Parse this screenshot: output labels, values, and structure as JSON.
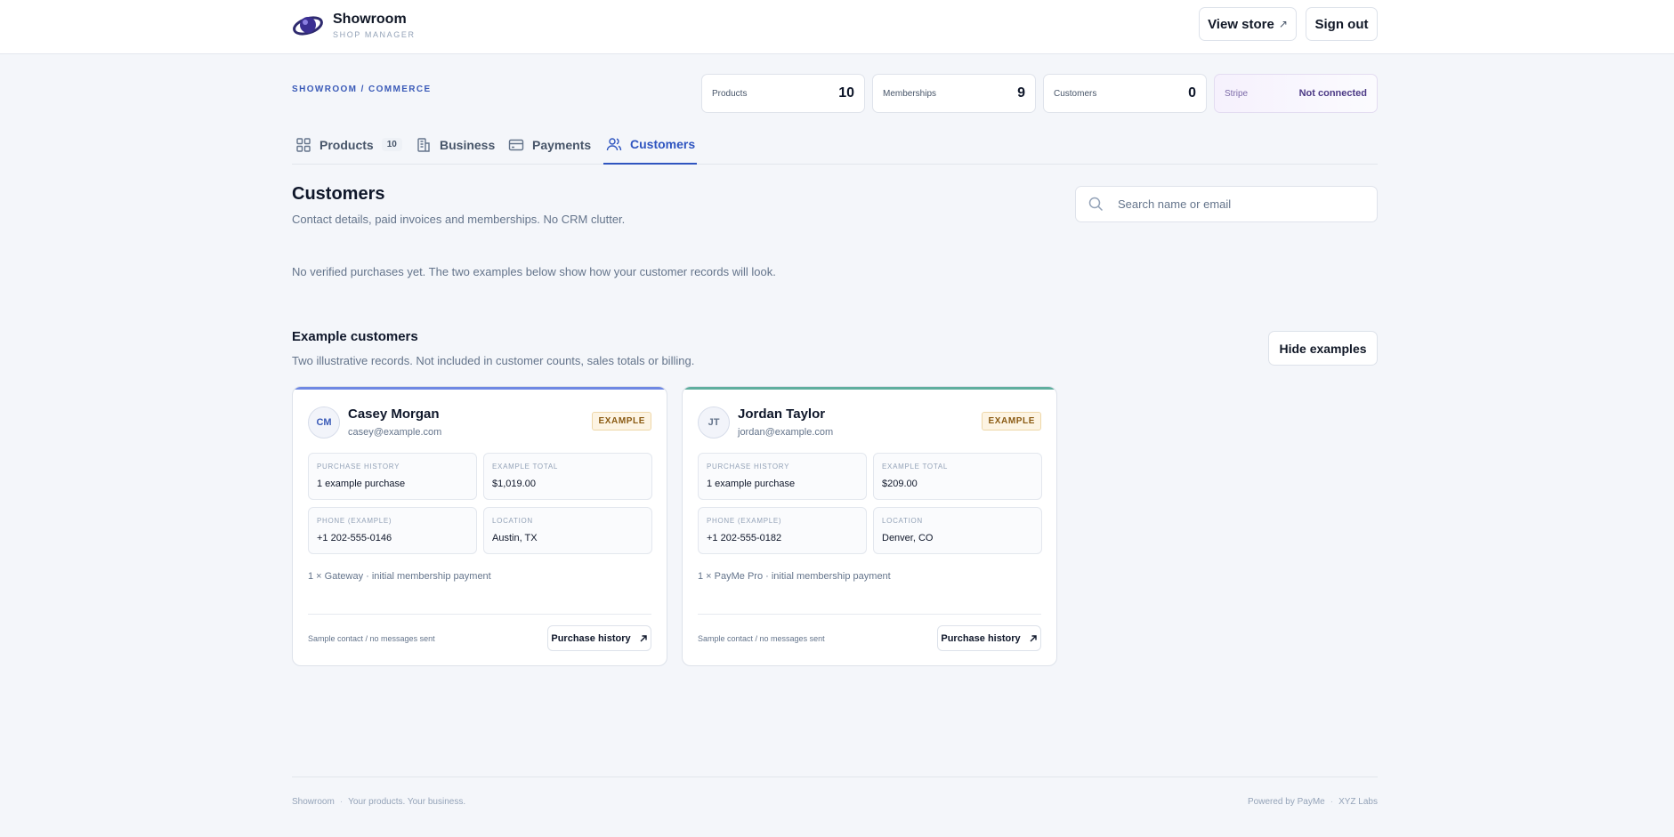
{
  "header": {
    "brand_name": "Showroom",
    "brand_sub": "SHOP MANAGER",
    "view_store_label": "View store",
    "sign_out_label": "Sign out"
  },
  "breadcrumb": "SHOWROOM / COMMERCE",
  "stats": [
    {
      "label": "Products",
      "value": "10"
    },
    {
      "label": "Memberships",
      "value": "9"
    },
    {
      "label": "Customers",
      "value": "0"
    },
    {
      "label": "Stripe",
      "value": "Not connected"
    }
  ],
  "tabs": [
    {
      "label": "Products",
      "badge": "10",
      "icon": "grid-icon"
    },
    {
      "label": "Business",
      "icon": "building-icon"
    },
    {
      "label": "Payments",
      "icon": "card-icon"
    },
    {
      "label": "Customers",
      "icon": "users-icon",
      "active": true
    }
  ],
  "main": {
    "title": "Customers",
    "subtitle": "Contact details, paid invoices and memberships. No CRM clutter.",
    "search_placeholder": "Search name or email",
    "notice": "No verified purchases yet. The two examples below show how your customer records will look."
  },
  "examples": {
    "title": "Example customers",
    "subtitle": "Two illustrative records. Not included in customer counts, sales totals or billing.",
    "hide_label": "Hide examples",
    "cards": [
      {
        "initials": "CM",
        "name": "Casey Morgan",
        "email": "casey@example.com",
        "badge": "EXAMPLE",
        "purchase_history_label": "PURCHASE HISTORY",
        "purchase_history": "1 example purchase",
        "total_label": "EXAMPLE TOTAL",
        "total": "$1,019.00",
        "phone_label": "PHONE (EXAMPLE)",
        "phone": "+1 202-555-0146",
        "location_label": "LOCATION",
        "location": "Austin, TX",
        "line_item": "1 × Gateway · initial membership payment",
        "note": "Sample contact / no messages sent",
        "button": "Purchase history",
        "accent": "#6f88e3"
      },
      {
        "initials": "JT",
        "name": "Jordan Taylor",
        "email": "jordan@example.com",
        "badge": "EXAMPLE",
        "purchase_history_label": "PURCHASE HISTORY",
        "purchase_history": "1 example purchase",
        "total_label": "EXAMPLE TOTAL",
        "total": "$209.00",
        "phone_label": "PHONE (EXAMPLE)",
        "phone": "+1 202-555-0182",
        "location_label": "LOCATION",
        "location": "Denver, CO",
        "line_item": "1 × PayMe Pro · initial membership payment",
        "note": "Sample contact / no messages sent",
        "button": "Purchase history",
        "accent": "#5fae9e"
      }
    ]
  },
  "footer": {
    "left_1": "Showroom",
    "left_2": "Your products. Your business.",
    "right_1": "Powered by PayMe",
    "right_2": "XYZ Labs"
  },
  "colors": {
    "accent": "#2f55c0",
    "background": "#f4f6fa"
  }
}
